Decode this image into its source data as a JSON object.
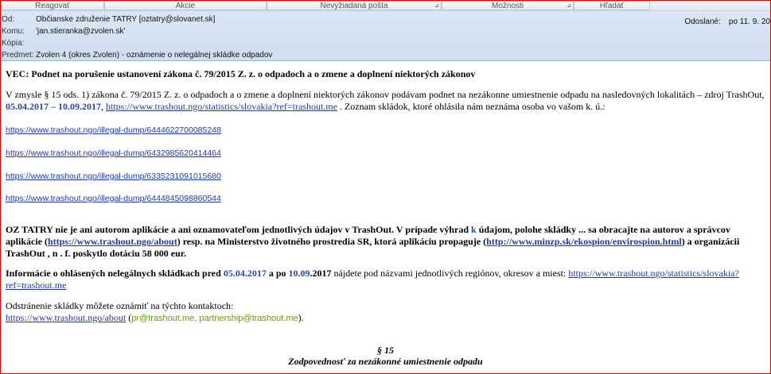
{
  "toolbar": {
    "reply": "Reagovať",
    "actions": "Akcie",
    "junk": "Nevyžiadaná pošta",
    "options": "Možnosti",
    "find": "Hľadať"
  },
  "header": {
    "from_label": "Od:",
    "from_value": "Občianske združenie TATRY [oztatry@slovanet.sk]",
    "to_label": "Komu:",
    "to_value": "'jan.stieranka@zvolen.sk'",
    "cc_label": "Kópia:",
    "cc_value": "",
    "subject_label": "Predmet:",
    "subject_value": "Zvolen 4 (okres Zvolen) - oznámenie o nelegálnej skládke odpadov",
    "sent_label": "Odoslané:",
    "sent_value": "po 11. 9. 20"
  },
  "body": {
    "heading": "VEC: Podnet na porušenie ustanovení zákona č. 79/2015  Z. z. o odpadoch a o zmene   a doplnení niektorých zákonov",
    "p1_a": "V zmysle § 15 ods. 1) zákona č. 79/2015  Z. z. o odpadoch a o zmene  a doplnení niektorých zákonov podávam podnet na nezákonne umiestnenie odpadu na nasledovných lokalitách – zdroj TrashOut, ",
    "p1_date1": "05.04.2017",
    "p1_dash": " – ",
    "p1_date2": "10.09.2017",
    "p1_comma": ",   ",
    "p1_link": "https://www.trashout.ngo/statistics/slovakia?ref=trashout.me",
    "p1_b": " . Zoznam skládok, ktoré ohlásila nám neznáma osoba vo vašom k. ú.:",
    "links": [
      "https://www.trashout.ngo/illegal-dump/6444622700085248",
      "https://www.trashout.ngo/illegal-dump/6432985620414464",
      "https://www.trashout.ngo/illegal-dump/6335231091015680",
      "https://www.trashout.ngo/illegal-dump/6444845098860544"
    ],
    "p2_a": "OZ TATRY nie je ani autorom aplikácie a ani oznamovateľom jednotlivých údajov v  TrashOut. V prípade výhrad ",
    "p2_k": "k",
    "p2_b": " údajom, polohe skládky ... sa obracajte na autorov a správcov aplikácie (",
    "p2_link1": "https://www.trashout.ngo/about",
    "p2_c": ") resp. na Ministerstvo životného prostredia SR, ktorá aplikáciu propaguje (",
    "p2_link2": "http://www.minzp.sk/ekospion/envirospion.html",
    "p2_d": ") a organizácii TrashOut , n . f. poskytlo dotáciu 58 000 eur.",
    "p3_a": "Informácie o ohlásených nelegálnych skládkach pred ",
    "p3_date1": "05.04.2017",
    "p3_mid": " a po ",
    "p3_date2": "10.09",
    "p3_year": ".2017",
    "p3_b": " nájdete pod názvami jednotlivých regiónov, okresov a miest:   ",
    "p3_link": "https://www.trashout.ngo/statistics/slovakia?ref=trashout.me",
    "p4_a": "Odstránenie skládky môžete oznámiť na týchto kontaktoch:",
    "p4_link": "https://www.trashout.ngo/about",
    "p4_open": "  (",
    "p4_email1": "pr@trashout.me",
    "p4_sep": ", ",
    "p4_email2": "partnership@trashout.me",
    "p4_close": ").",
    "section": "§ 15",
    "section_title": "Zodpovednosť za nezákonné umiestnenie odpadu"
  },
  "colors": {
    "link": "#1f39a8",
    "date_blue": "#2a44b0",
    "email_green": "#6a9a12",
    "header_bg": "#d6e3f3",
    "frame": "#e00000"
  }
}
